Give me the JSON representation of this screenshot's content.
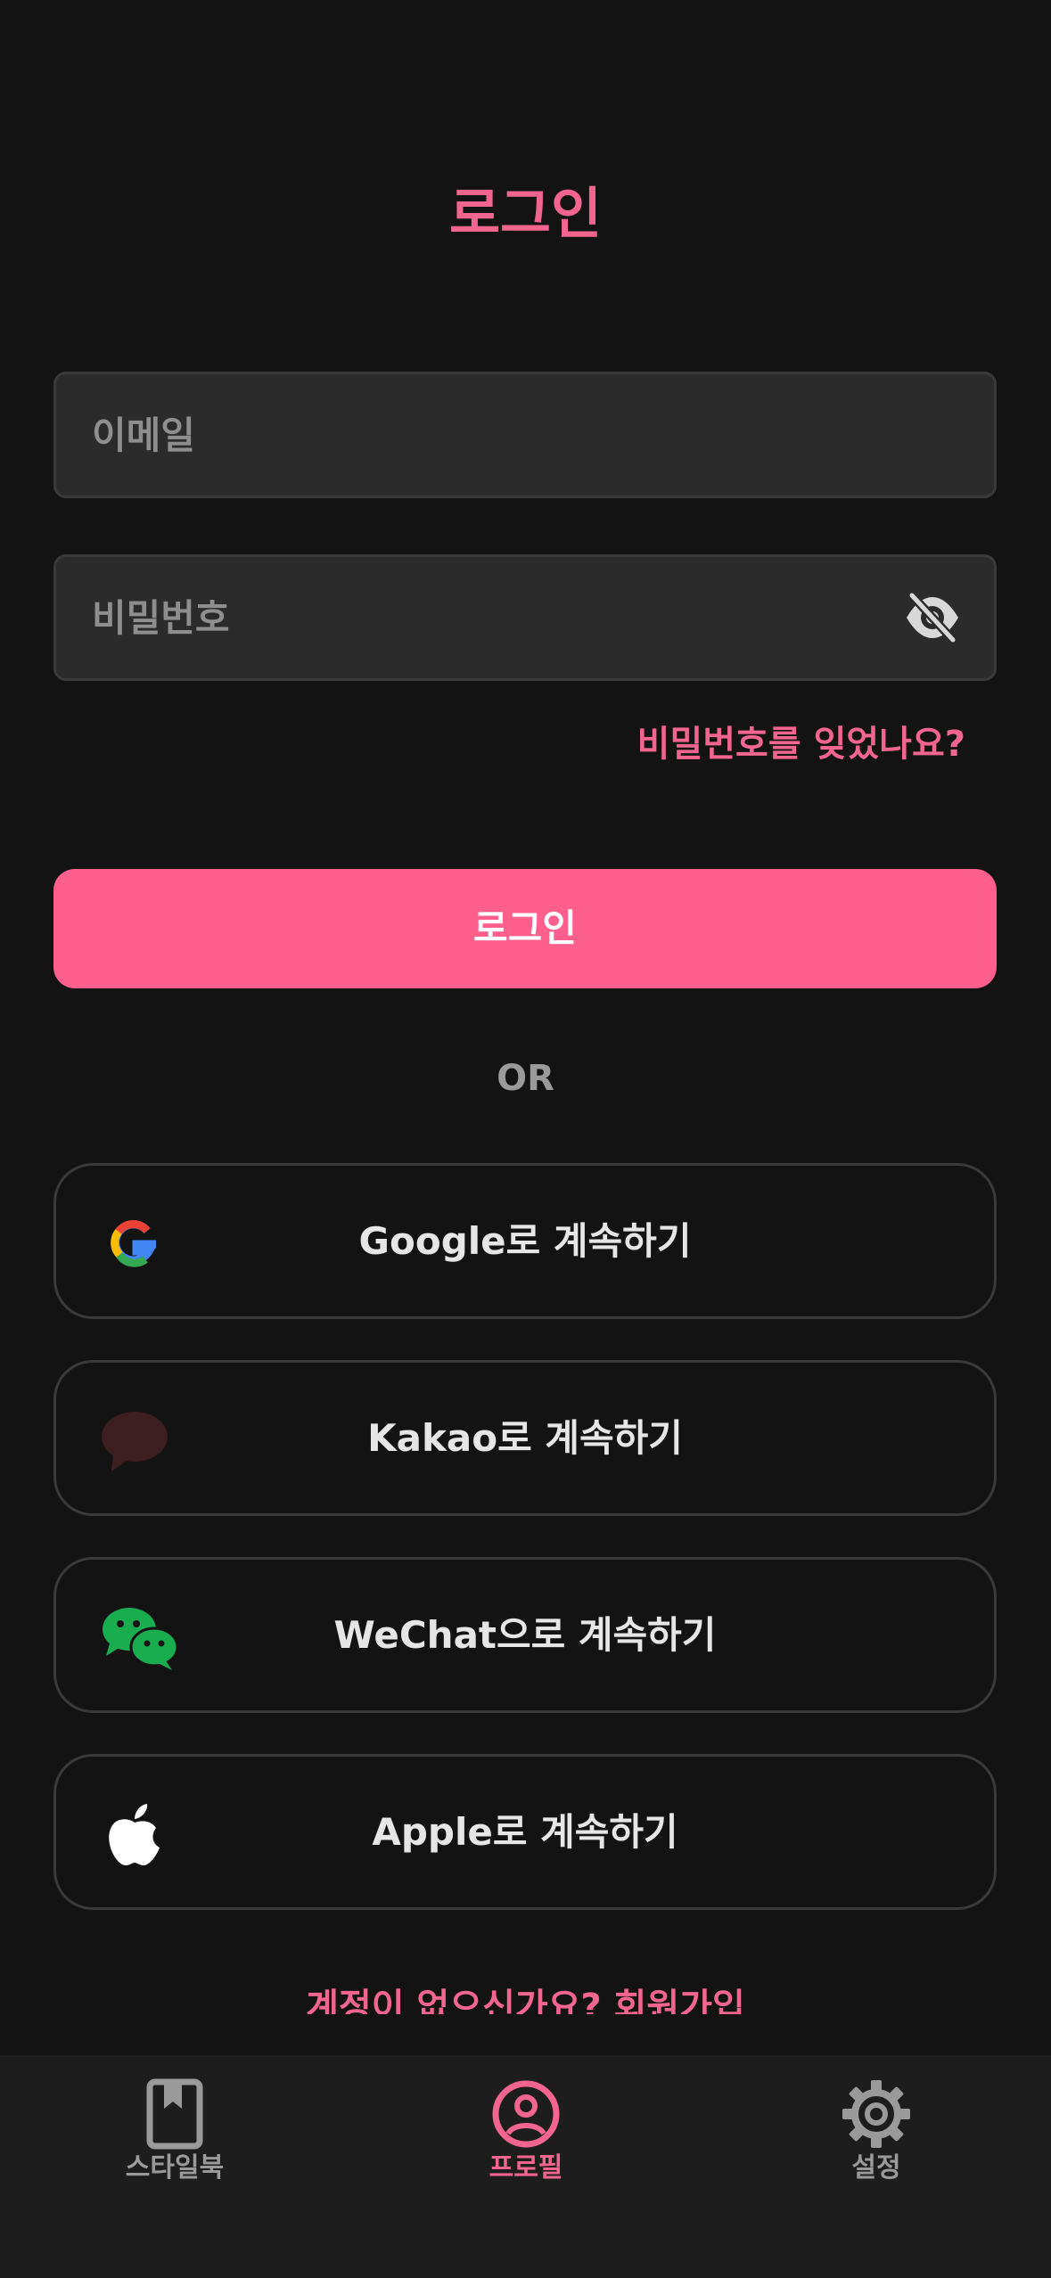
{
  "header": {
    "title": "로그인"
  },
  "form": {
    "email_placeholder": "이메일",
    "email_value": "",
    "password_placeholder": "비밀번호",
    "password_value": "",
    "forgot_password": "비밀번호를 잊었나요?",
    "login_button": "로그인"
  },
  "divider": {
    "label": "OR"
  },
  "social": [
    {
      "label": "Google로 계속하기",
      "icon": "google-icon"
    },
    {
      "label": "Kakao로 계속하기",
      "icon": "kakao-talk-icon"
    },
    {
      "label": "WeChat으로 계속하기",
      "icon": "wechat-icon"
    },
    {
      "label": "Apple로 계속하기",
      "icon": "apple-icon"
    }
  ],
  "signup": {
    "label": "계정이 없으신가요? 회원가입"
  },
  "bottom_nav": {
    "items": [
      {
        "label": "스타일북",
        "icon": "bookmark-book-icon",
        "active": false
      },
      {
        "label": "프로필",
        "icon": "user-circle-icon",
        "active": true
      },
      {
        "label": "설정",
        "icon": "gear-icon",
        "active": false
      }
    ]
  },
  "colors": {
    "accent": "#ff5f8d",
    "accent_text": "#f26591",
    "background": "#131313",
    "field_bg": "#2b2b2b",
    "nav_bg": "#1d1d1d"
  }
}
